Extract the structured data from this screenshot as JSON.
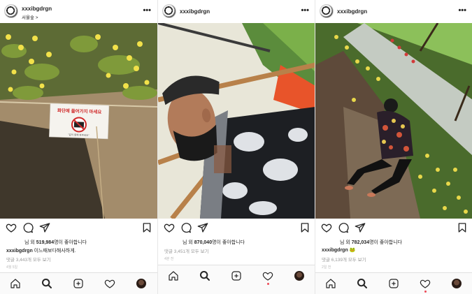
{
  "posts": [
    {
      "username": "xxxibgdrgn",
      "location": "서울숲 >",
      "sign_text": "화단에 들어가지 마세요",
      "sign_sub": "\"같이 함께 봐주세요\"",
      "likes_prefix": "님 외 ",
      "likes_count": "519,984",
      "likes_suffix": "명이 좋아합니다",
      "caption_user": "xxxibgdrgn",
      "caption_text": " 이느때보다해사하게.",
      "comments": "댓글 3,443개 모두 보기",
      "time": "4월 5일"
    },
    {
      "username": "xxxibgdrgn",
      "likes_prefix": "님 외 ",
      "likes_count": "870,040",
      "likes_suffix": "명이 좋아합니다",
      "comments": "댓글 3,451개 모두 보기",
      "time": "4분 전"
    },
    {
      "username": "xxxibgdrgn",
      "likes_prefix": "님 외 ",
      "likes_count": "782,034",
      "likes_suffix": "명이 좋아합니다",
      "caption_user": "xxxibgdrgn",
      "caption_text": " 🐸",
      "comments": "댓글 6,139개 모두 보기",
      "time": "2일 전"
    }
  ],
  "icons": {
    "more": "more-options-icon",
    "like": "heart-icon",
    "comment": "comment-icon",
    "share": "send-icon",
    "save": "bookmark-icon",
    "home": "home-icon",
    "search": "search-icon",
    "new_post": "new-post-icon",
    "activity": "activity-heart-icon",
    "profile": "profile-avatar"
  },
  "colors": {
    "notification_dot": "#ed4956",
    "text": "#262626",
    "muted": "#999999"
  }
}
